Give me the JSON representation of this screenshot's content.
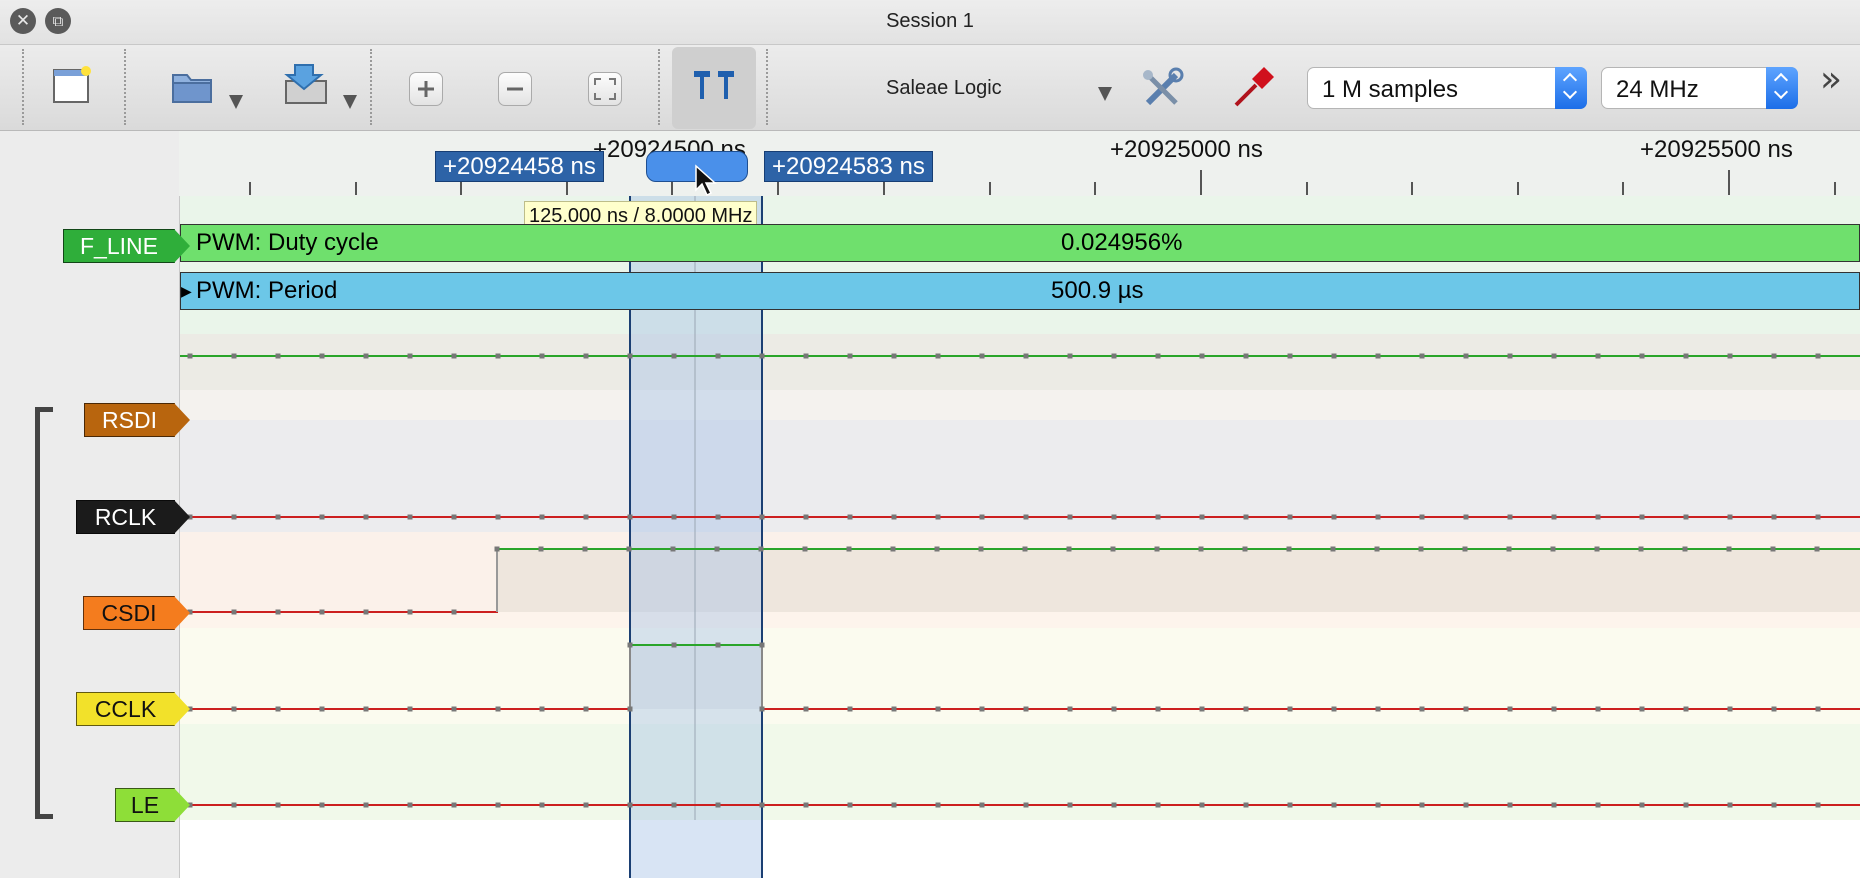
{
  "window": {
    "title": "Session 1",
    "close_glyph": "✕",
    "restore_glyph": "⧉"
  },
  "toolbar": {
    "device_name": "Saleae Logic",
    "samples": "1 M samples",
    "rate": "24 MHz",
    "more_glyph": "»"
  },
  "ruler": {
    "tick_labels": [
      "+20924500 ns",
      "+20925000 ns",
      "+20925500 ns"
    ],
    "marker_left": "+20924458 ns",
    "marker_right": "+20924583 ns",
    "tooltip": "125.000 ns / 8.0000 MHz"
  },
  "channels": {
    "f_line": {
      "label": "F_LINE",
      "color": "#2fae3a"
    },
    "rsdi": {
      "label": "RSDI",
      "color": "#b8650e"
    },
    "rclk": {
      "label": "RCLK",
      "color": "#1b1b1b"
    },
    "csdi": {
      "label": "CSDI",
      "color": "#f47c1e"
    },
    "cclk": {
      "label": "CCLK",
      "color": "#f2e12a"
    },
    "le": {
      "label": "LE",
      "color": "#8ede38"
    }
  },
  "analyzers": {
    "duty": {
      "label": "PWM: Duty cycle",
      "value": "0.024956%",
      "color": "#6fe06d"
    },
    "period": {
      "label": "PWM: Period",
      "value": "500.9 µs",
      "color": "#6cc7e8"
    }
  },
  "signals": [
    {
      "channel": "F_LINE",
      "state": "high"
    },
    {
      "channel": "RSDI",
      "state": "none"
    },
    {
      "channel": "RCLK",
      "state": "low"
    },
    {
      "channel": "CSDI",
      "state": "low→high"
    },
    {
      "channel": "CCLK",
      "state": "pulse"
    },
    {
      "channel": "LE",
      "state": "low"
    }
  ]
}
